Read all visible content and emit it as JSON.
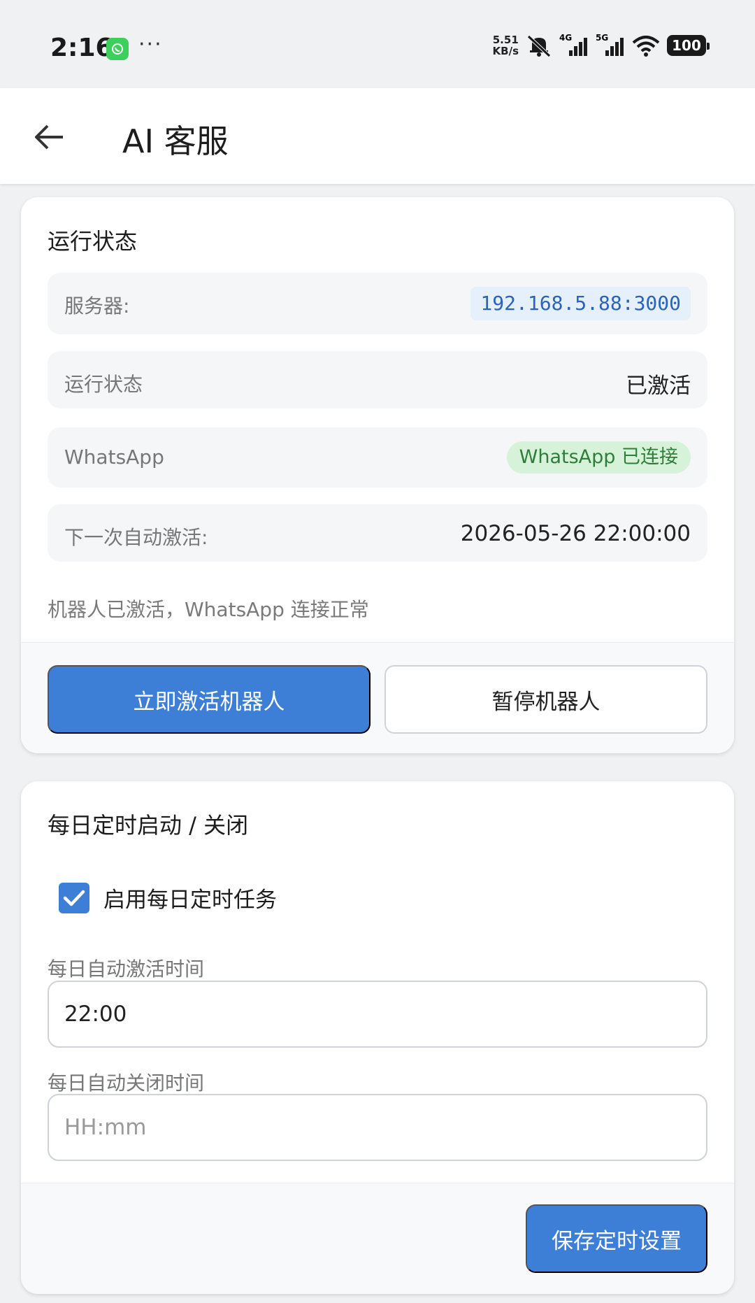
{
  "status_bar": {
    "time": "2:16",
    "more": "···",
    "net_speed_value": "5.51",
    "net_speed_unit": "KB/s",
    "net_4g": "4G",
    "net_5g": "5G",
    "battery": "100"
  },
  "app_bar": {
    "title": "AI 客服"
  },
  "run_card": {
    "title": "运行状态",
    "server_label": "服务器:",
    "server_value": "192.168.5.88:3000",
    "status_label": "运行状态",
    "status_value": "已激活",
    "whatsapp_label": "WhatsApp",
    "whatsapp_badge": "WhatsApp 已连接",
    "next_label": "下一次自动激活:",
    "next_value": "2026-05-26 22:00:00",
    "summary": "机器人已激活，WhatsApp 连接正常",
    "activate_button": "立即激活机器人",
    "pause_button": "暂停机器人"
  },
  "schedule_card": {
    "title": "每日定时启动 / 关闭",
    "enable_checked": true,
    "enable_label": "启用每日定时任务",
    "activate_time_label": "每日自动激活时间",
    "activate_time_value": "22:00",
    "close_time_label": "每日自动关闭时间",
    "close_time_value": "",
    "close_time_placeholder": "HH:mm",
    "save_button": "保存定时设置"
  },
  "colors": {
    "primary": "#3d7ed6",
    "badge_green_bg": "#d6f3d9",
    "badge_green_text": "#2f7d3a",
    "ip_chip_bg": "#e6f0fb",
    "ip_chip_text": "#2a63b8"
  }
}
